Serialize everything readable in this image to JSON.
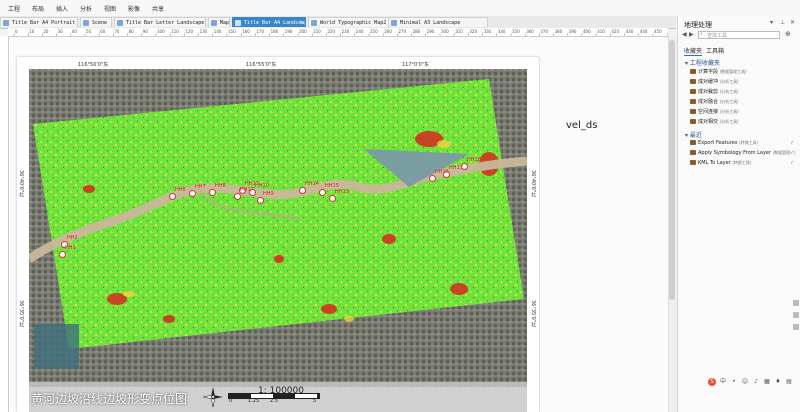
{
  "menubar": [
    "工程",
    "布局",
    "插入",
    "分析",
    "视图",
    "影像",
    "共享"
  ],
  "tabs": [
    {
      "label": "Title Bar A4 Portrait",
      "active": false
    },
    {
      "label": "Scene",
      "active": false
    },
    {
      "label": "Title Bar Letter Landscape",
      "active": false
    },
    {
      "label": "Map",
      "active": false
    },
    {
      "label": "Title Bar A4 Landscape",
      "active": true
    },
    {
      "label": "World Typographic Map2",
      "active": false
    },
    {
      "label": "Minimal A3 Landscape",
      "active": false
    }
  ],
  "ruler_h": [
    "0",
    "10",
    "20",
    "30",
    "40",
    "50",
    "60",
    "70",
    "80",
    "90",
    "100",
    "110",
    "120",
    "130",
    "140",
    "150",
    "160",
    "170",
    "180",
    "190",
    "200",
    "210",
    "220",
    "230",
    "240",
    "250",
    "260",
    "270",
    "280",
    "290",
    "300",
    "310",
    "320",
    "330",
    "340",
    "350",
    "360",
    "370",
    "380",
    "390",
    "400",
    "410",
    "420",
    "430",
    "440",
    "450",
    "460"
  ],
  "map": {
    "top_coords": [
      "116°50'0\"东",
      "116°55'0\"东",
      "117°0'0\"东"
    ],
    "left_coords": [
      "36°40'0\"北",
      "36°35'0\"北"
    ],
    "right_coords": [
      "36°40'0\"北",
      "36°35'0\"北"
    ],
    "title": "黄河边坡沿线边坡形变点位图",
    "scale_text": "1: 100000",
    "scalebar_labels": [
      "0",
      "1.25",
      "2.5",
      "5"
    ],
    "north_label": "N",
    "markers": [
      "HH18",
      "HH17",
      "HH16",
      "HH15",
      "HH14",
      "HH13",
      "HH12",
      "HH11",
      "HH10",
      "HH9",
      "HH8",
      "HH7",
      "HH6",
      "HH2",
      "HH1"
    ]
  },
  "legend_label": "vel_ds",
  "panel": {
    "title": "地理处理",
    "search_placeholder": "查找工具",
    "tab_favorites": "收藏夹",
    "tab_toolbox": "工具箱",
    "section_project": "工程收藏夹",
    "project_tools": [
      {
        "name": "计算字段",
        "sub": "(数据管理工具)"
      },
      {
        "name": "成对缓冲",
        "sub": "(分析工具)"
      },
      {
        "name": "成对裁剪",
        "sub": "(分析工具)"
      },
      {
        "name": "成对融合",
        "sub": "(分析工具)"
      },
      {
        "name": "空间连接",
        "sub": "(分析工具)"
      },
      {
        "name": "成对相交",
        "sub": "(分析工具)"
      }
    ],
    "section_recent": "最近",
    "recent_tools": [
      {
        "name": "Export Features",
        "sub": "(转换工具)"
      },
      {
        "name": "Apply Symbology From Layer",
        "sub": "(数据管理…)"
      },
      {
        "name": "KML To Layer",
        "sub": "(转换工具)"
      }
    ]
  },
  "taskbar": {
    "ime": "中"
  },
  "colors": {
    "accent": "#3b86c8",
    "map_green": "#6ee83a",
    "map_red": "#d62a1e",
    "river": "#c9b79a"
  }
}
